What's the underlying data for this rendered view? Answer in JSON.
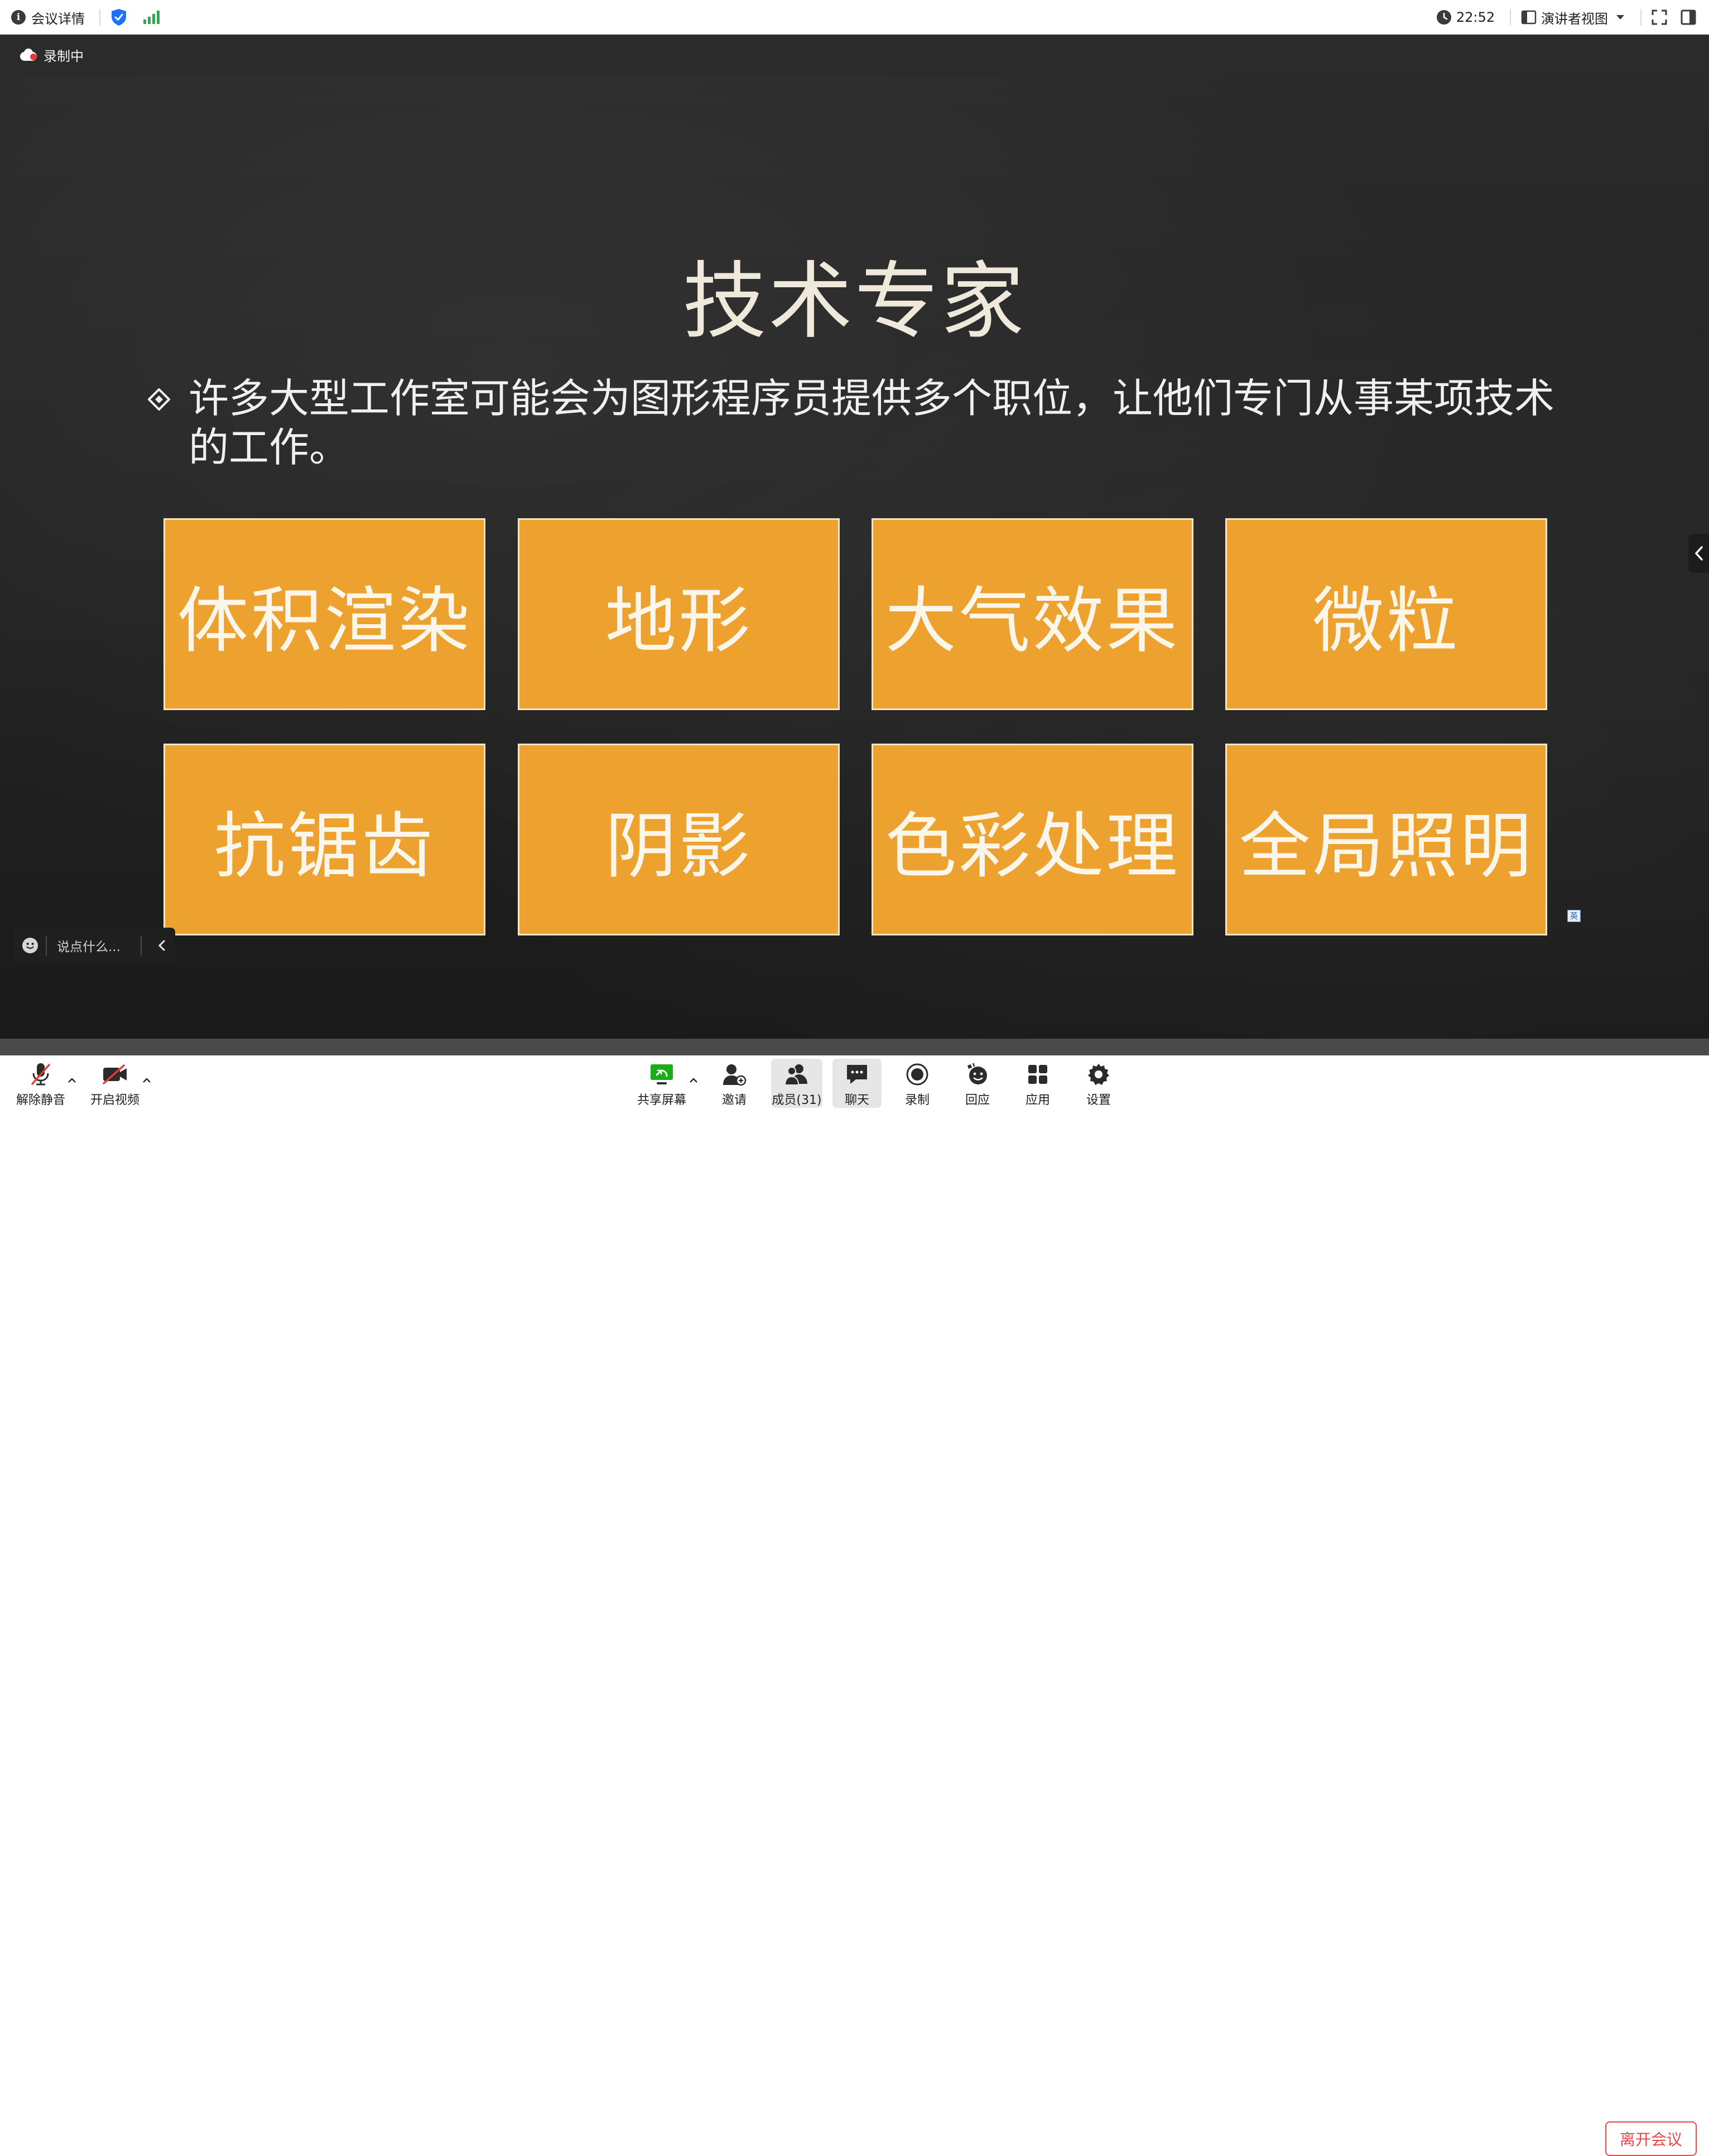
{
  "topbar": {
    "meeting_details": "会议详情",
    "clock": "22:52",
    "view_mode": "演讲者视图"
  },
  "meeting": {
    "recording_label": "录制中"
  },
  "slide": {
    "title": "技术专家",
    "bullet": "许多大型工作室可能会为图形程序员提供多个职位，让他们专门从事某项技术的工作。",
    "boxes": [
      "体积渲染",
      "地形",
      "大气效果",
      "微粒",
      "抗锯齿",
      "阴影",
      "色彩处理",
      "全局照明"
    ],
    "box_color": "#eda12e"
  },
  "lang_badge": "英",
  "chat": {
    "placeholder": "说点什么..."
  },
  "toolbar": {
    "unmute": "解除静音",
    "start_video": "开启视频",
    "share_screen": "共享屏幕",
    "invite": "邀请",
    "members": "成员(31)",
    "chat": "聊天",
    "record": "录制",
    "reactions": "回应",
    "apps": "应用",
    "settings": "设置",
    "leave": "离开会议"
  },
  "colors": {
    "share_green": "#1aad19",
    "signal_green": "#22b14c",
    "shield_blue": "#1e6fff",
    "leave_red": "#e5484d",
    "record_red": "#e53935"
  }
}
